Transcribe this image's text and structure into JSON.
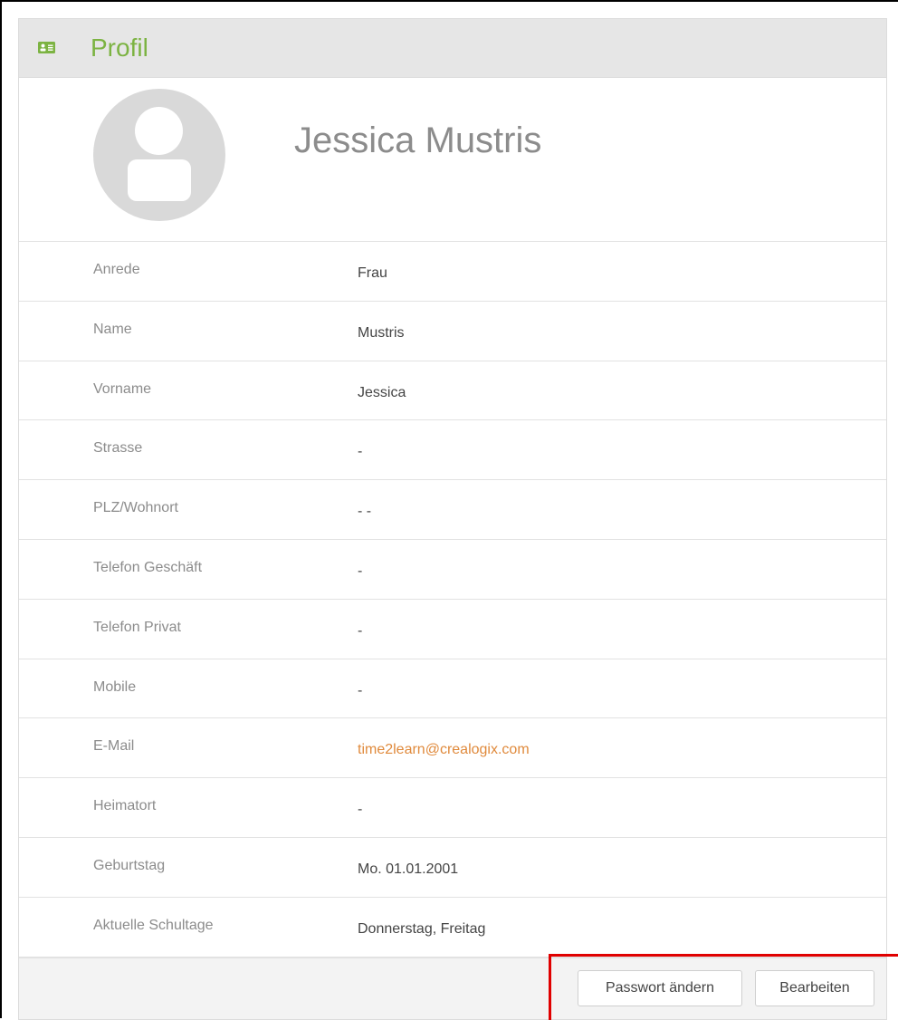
{
  "header": {
    "title": "Profil",
    "icon": "contact-card-icon",
    "accent_color": "#7cb342"
  },
  "profile": {
    "full_name": "Jessica Mustris",
    "avatar": "user-avatar-placeholder"
  },
  "fields": [
    {
      "label": "Anrede",
      "value": "Frau"
    },
    {
      "label": "Name",
      "value": "Mustris"
    },
    {
      "label": "Vorname",
      "value": "Jessica"
    },
    {
      "label": "Strasse",
      "value": "-"
    },
    {
      "label": "PLZ/Wohnort",
      "value": "- -"
    },
    {
      "label": "Telefon Geschäft",
      "value": "-"
    },
    {
      "label": "Telefon Privat",
      "value": "-"
    },
    {
      "label": "Mobile",
      "value": "-"
    },
    {
      "label": "E-Mail",
      "value": "time2learn@crealogix.com"
    },
    {
      "label": "Heimatort",
      "value": "-"
    },
    {
      "label": "Geburtstag",
      "value": "Mo. 01.01.2001"
    },
    {
      "label": "Aktuelle Schultage",
      "value": "Donnerstag, Freitag"
    }
  ],
  "footer": {
    "change_password_label": "Passwort ändern",
    "edit_label": "Bearbeiten"
  },
  "colors": {
    "email_link": "#e08a3c",
    "highlight_border": "#e00000"
  }
}
